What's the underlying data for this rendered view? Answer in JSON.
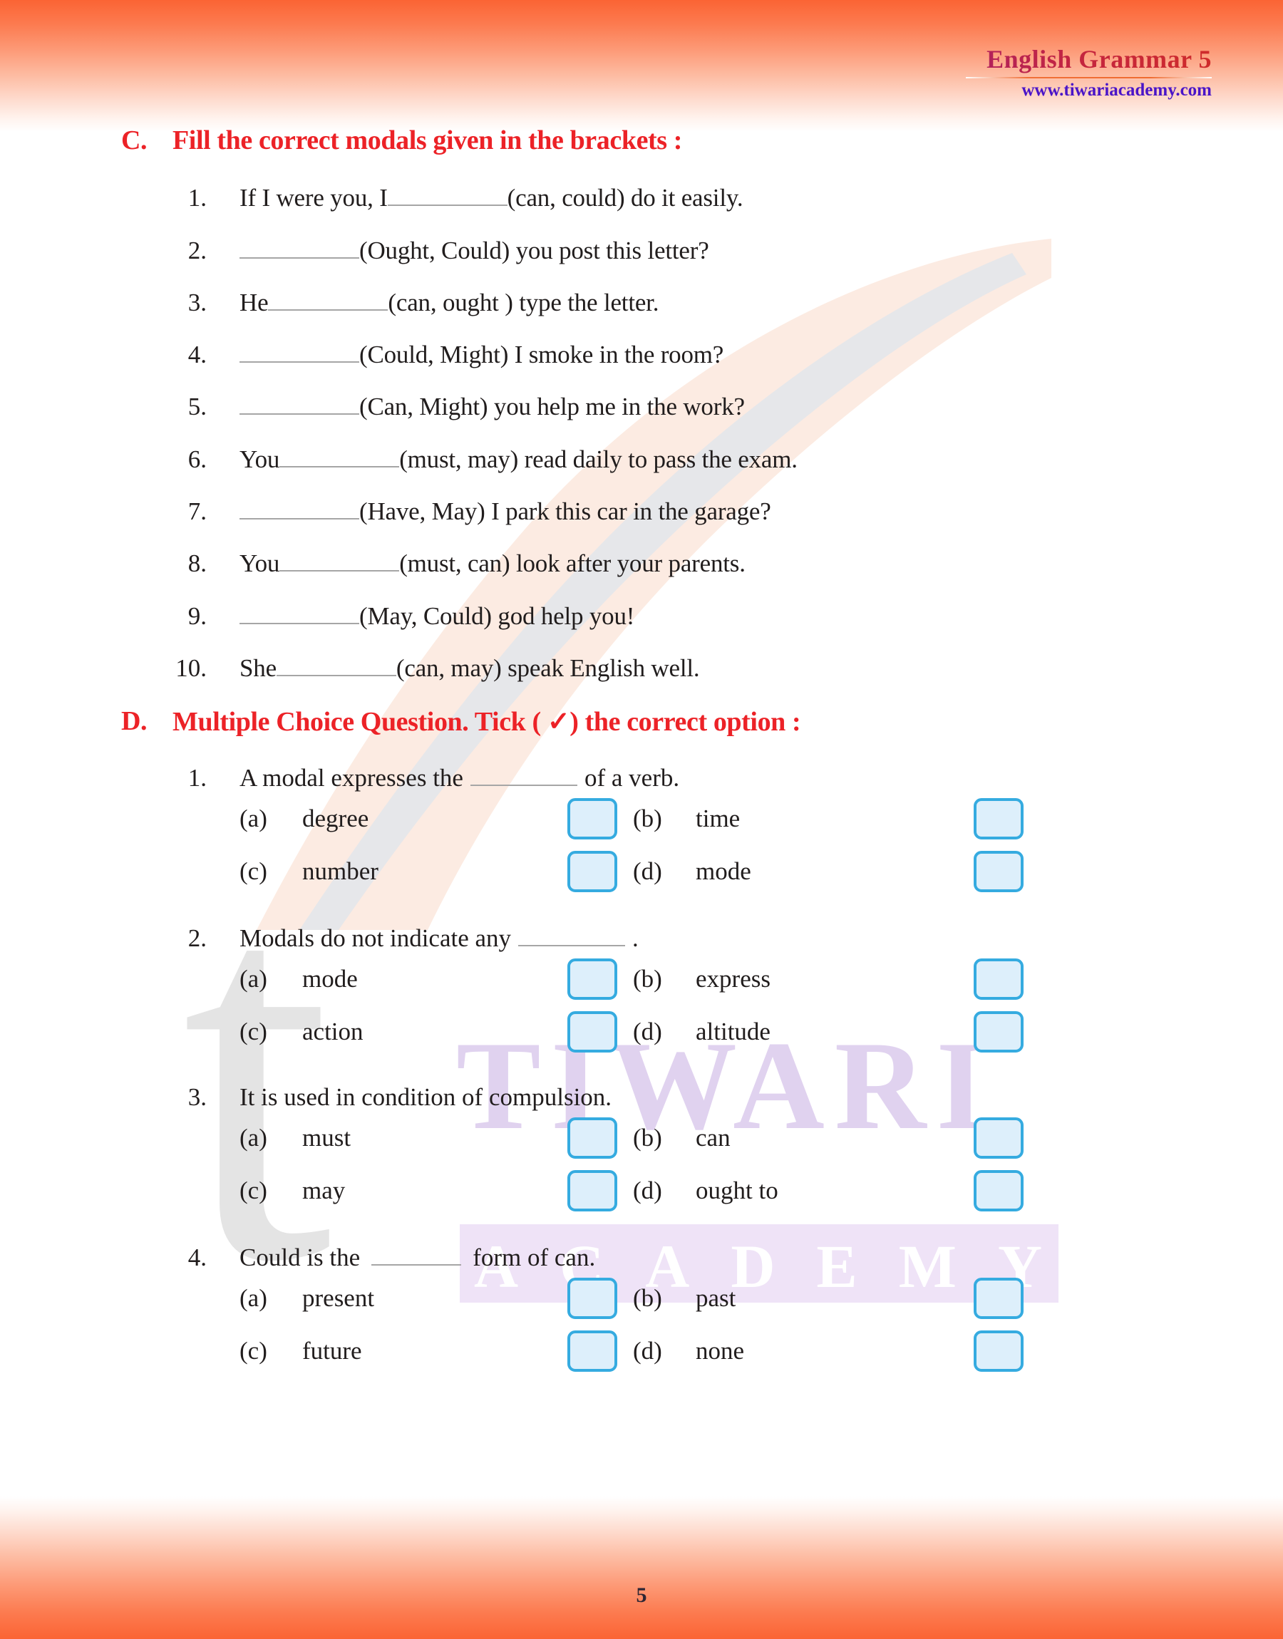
{
  "header": {
    "title": "English Grammar 5",
    "website": "www.tiwariacademy.com"
  },
  "watermarks": {
    "letter": "t",
    "brand_top": "TIWARI",
    "brand_bottom": "ACADEMY"
  },
  "colors": {
    "heading_red": "#ec2227",
    "band_orange": "#fb6434",
    "site_purple": "#4a15c8",
    "checkbox_border": "#35abe0",
    "checkbox_fill": "#ddeffb",
    "blank_line": "#a6a6a6",
    "watermark_purple": "#e0d2ef",
    "watermark_gray": "#e4e4e4"
  },
  "sections": [
    {
      "letter": "C.",
      "title": "Fill the correct modals given in the brackets :",
      "items": [
        {
          "num": "1.",
          "pre": "If I were you, I",
          "blank": "b-lg",
          "post": "(can, could) do it easily."
        },
        {
          "num": "2.",
          "pre": "",
          "blank": "b-lg",
          "post": "(Ought, Could) you post this letter?"
        },
        {
          "num": "3.",
          "pre": "He",
          "blank": "b-lg",
          "post": "(can, ought ) type the letter."
        },
        {
          "num": "4.",
          "pre": "",
          "blank": "b-lg",
          "post": "(Could, Might) I smoke in the room?"
        },
        {
          "num": "5.",
          "pre": "",
          "blank": "b-lg",
          "post": "(Can, Might) you help me in the work?"
        },
        {
          "num": "6.",
          "pre": "You",
          "blank": "b-lg",
          "post": "(must, may) read daily to pass the exam."
        },
        {
          "num": "7.",
          "pre": "",
          "blank": "b-lg",
          "post": "(Have, May) I park this car in the garage?"
        },
        {
          "num": "8.",
          "pre": "You",
          "blank": "b-lg",
          "post": "(must, can) look after your parents."
        },
        {
          "num": "9.",
          "pre": "",
          "blank": "b-lg",
          "post": "(May, Could) god help you!"
        },
        {
          "num": "10.",
          "pre": "She",
          "blank": "b-lg",
          "post": "(can, may) speak English well."
        }
      ]
    },
    {
      "letter": "D.",
      "title": "Multiple Choice Question. Tick ( ✓) the correct option :",
      "questions": [
        {
          "num": "1.",
          "stem_pre": "A modal expresses the",
          "stem_blank": "b-md",
          "stem_post": "of a verb.",
          "options": [
            {
              "tag": "(a)",
              "label": "degree"
            },
            {
              "tag": "(b)",
              "label": "time"
            },
            {
              "tag": "(c)",
              "label": "number"
            },
            {
              "tag": "(d)",
              "label": "mode"
            }
          ]
        },
        {
          "num": "2.",
          "stem_pre": "Modals do not indicate any",
          "stem_blank": "b-md",
          "stem_post": ".",
          "options": [
            {
              "tag": "(a)",
              "label": "mode"
            },
            {
              "tag": "(b)",
              "label": "express"
            },
            {
              "tag": "(c)",
              "label": "action"
            },
            {
              "tag": "(d)",
              "label": "altitude"
            }
          ]
        },
        {
          "num": "3.",
          "stem_pre": "It is used in condition of compulsion.",
          "stem_blank": "",
          "stem_post": "",
          "options": [
            {
              "tag": "(a)",
              "label": "must"
            },
            {
              "tag": "(b)",
              "label": "can"
            },
            {
              "tag": "(c)",
              "label": "may"
            },
            {
              "tag": "(d)",
              "label": "ought to"
            }
          ]
        },
        {
          "num": "4.",
          "stem_pre": "Could is the",
          "stem_blank": "b-sm",
          "stem_post": "form of can.",
          "options": [
            {
              "tag": "(a)",
              "label": "present"
            },
            {
              "tag": "(b)",
              "label": "past"
            },
            {
              "tag": "(c)",
              "label": "future"
            },
            {
              "tag": "(d)",
              "label": "none"
            }
          ]
        }
      ]
    }
  ],
  "footer": {
    "page_number": "5"
  }
}
